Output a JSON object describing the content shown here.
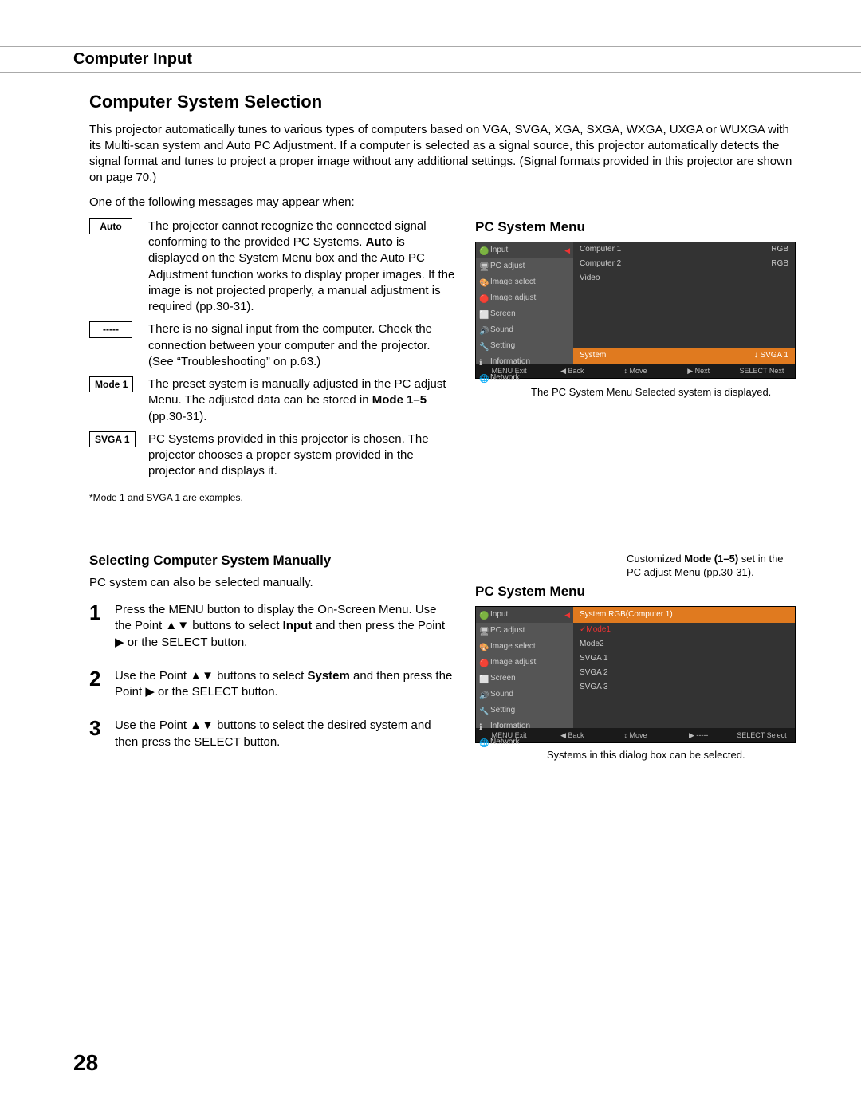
{
  "header": {
    "section": "Computer Input"
  },
  "title": "Computer System Selection",
  "intro": "This projector automatically tunes to various types of computers based on VGA, SVGA, XGA, SXGA, WXGA, UXGA or WUXGA with its Multi-scan system and Auto PC Adjustment. If a computer is selected as a signal source, this projector automatically detects the signal format and tunes to project a proper image without any additional settings. (Signal formats provided in this projector are shown on page 70.)",
  "msg_intro": "One of the following messages may appear when:",
  "messages": {
    "auto": {
      "label": "Auto",
      "text_before_bold": "The projector cannot recognize the connected signal conforming to the provided PC Systems. ",
      "bold": "Auto",
      "text_after_bold": " is displayed on the System Menu box and the Auto PC Adjustment function works to display proper images. If the image is not projected properly, a manual adjustment is required (pp.30-31)."
    },
    "dashes": {
      "label": "-----",
      "text": "There is no signal input from the computer. Check the connection between your computer and the projector. (See “Troubleshooting” on p.63.)"
    },
    "mode1": {
      "label": "Mode 1",
      "text_before_bold": "The preset system is manually adjusted in the PC adjust Menu. The adjusted data can be stored in ",
      "bold": "Mode 1–5",
      "text_after_bold": " (pp.30-31)."
    },
    "svga1": {
      "label": "SVGA 1",
      "text": "PC Systems provided in this projector is chosen. The projector chooses a proper system provided in the projector and displays it."
    }
  },
  "footnote": "*Mode 1 and SVGA 1 are examples.",
  "osd1": {
    "title": "PC System Menu",
    "sidebar": [
      "Input",
      "PC adjust",
      "Image select",
      "Image adjust",
      "Screen",
      "Sound",
      "Setting",
      "Information",
      "Network"
    ],
    "rows": [
      {
        "c1": "Computer 1",
        "c2": "RGB"
      },
      {
        "c1": "Computer 2",
        "c2": "RGB"
      },
      {
        "c1": "Video",
        "c2": ""
      }
    ],
    "highlight": {
      "left": "System",
      "right": "SVGA 1"
    },
    "footer": [
      "MENU Exit",
      "◀ Back",
      "↕ Move",
      "▶ Next",
      "SELECT Next"
    ],
    "caption": "The PC System Menu Selected system is displayed."
  },
  "section2": {
    "title": "Selecting Computer System Manually",
    "intro": "PC system can also be selected manually.",
    "steps": [
      {
        "num": "1",
        "pre": "Press the MENU button to display the On-Screen Menu. Use the Point ▲▼ buttons to select ",
        "bold": "Input",
        "post": " and then press the Point ▶ or the SELECT button."
      },
      {
        "num": "2",
        "pre": "Use the Point ▲▼ buttons to select ",
        "bold": "System",
        "post": " and then press the Point ▶ or the SELECT button."
      },
      {
        "num": "3",
        "pre": "Use the Point ▲▼ buttons to select the desired system and then press the SELECT button.",
        "bold": "",
        "post": ""
      }
    ]
  },
  "osd2": {
    "title": "PC System Menu",
    "callout_pre": "Customized ",
    "callout_bold": "Mode (1–5)",
    "callout_post": " set in the PC adjust Menu (pp.30-31).",
    "sidebar": [
      "Input",
      "PC adjust",
      "Image select",
      "Image adjust",
      "Screen",
      "Sound",
      "Setting",
      "Information",
      "Network"
    ],
    "header_row": "System   RGB(Computer 1)",
    "list": [
      "Mode1",
      "Mode2",
      "SVGA 1",
      "SVGA 2",
      "SVGA 3"
    ],
    "footer": [
      "MENU Exit",
      "◀ Back",
      "↕ Move",
      "▶ -----",
      "SELECT Select"
    ],
    "caption": "Systems in this dialog box can be selected."
  },
  "page_number": "28"
}
